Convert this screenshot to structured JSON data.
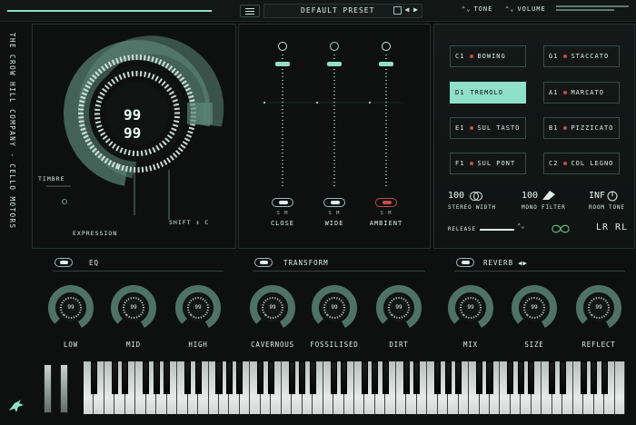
{
  "app": {
    "brand": "THE CROW HILL COMPANY  -  CELLO MOTORS",
    "accent": "#8fe0c6"
  },
  "topbar": {
    "preset": "DEFAULT PRESET",
    "preset_arrows": "◀ ▶",
    "tone_label": "TONE",
    "volume_label": "VOLUME",
    "chevron": "⌃⌄"
  },
  "main": {
    "dial_value_top": "99",
    "dial_value_bottom": "99",
    "timbre_label": "TIMBRE",
    "expression_label": "EXPRESSION",
    "shift_label": "SHIFT ⇕ C"
  },
  "mix": {
    "sm_label": "S  M",
    "faders": [
      {
        "name": "CLOSE",
        "level": 0.71
      },
      {
        "name": "WIDE",
        "level": 0.71
      },
      {
        "name": "AMBIENT",
        "level": 0.71
      }
    ]
  },
  "articulations": [
    {
      "key": "C1",
      "name": "BOWING",
      "active": false
    },
    {
      "key": "G1",
      "name": "STACCATO",
      "active": false
    },
    {
      "key": "D1",
      "name": "TREMOLO",
      "active": true
    },
    {
      "key": "A1",
      "name": "MARCATO",
      "active": false
    },
    {
      "key": "E1",
      "name": "SUL TASTO",
      "active": false
    },
    {
      "key": "B1",
      "name": "PIZZICATO",
      "active": false
    },
    {
      "key": "F1",
      "name": "SUL PONT",
      "active": false
    },
    {
      "key": "C2",
      "name": "COL LEGNO",
      "active": false
    }
  ],
  "stats": {
    "stereo_width_value": "100",
    "stereo_width_label": "STEREO WIDTH",
    "mono_filter_value": "100",
    "mono_filter_label": "MONO FILTER",
    "room_tone_value": "INF",
    "room_tone_label": "ROOM TONE",
    "release_label": "RELEASE",
    "lr_label": "LR RL"
  },
  "sections": {
    "eq": "EQ",
    "transform": "TRANSFORM",
    "reverb": "REVERB",
    "reverb_arrows": "◀▶"
  },
  "knobs": [
    {
      "label": "LOW",
      "value": "99"
    },
    {
      "label": "MID",
      "value": "99"
    },
    {
      "label": "HIGH",
      "value": "99"
    },
    {
      "label": "CAVERNOUS",
      "value": "99"
    },
    {
      "label": "FOSSILISED",
      "value": "99"
    },
    {
      "label": "DIRT",
      "value": "99"
    },
    {
      "label": "MIX",
      "value": "99"
    },
    {
      "label": "SIZE",
      "value": "99"
    },
    {
      "label": "REFLECT",
      "value": "99"
    }
  ]
}
